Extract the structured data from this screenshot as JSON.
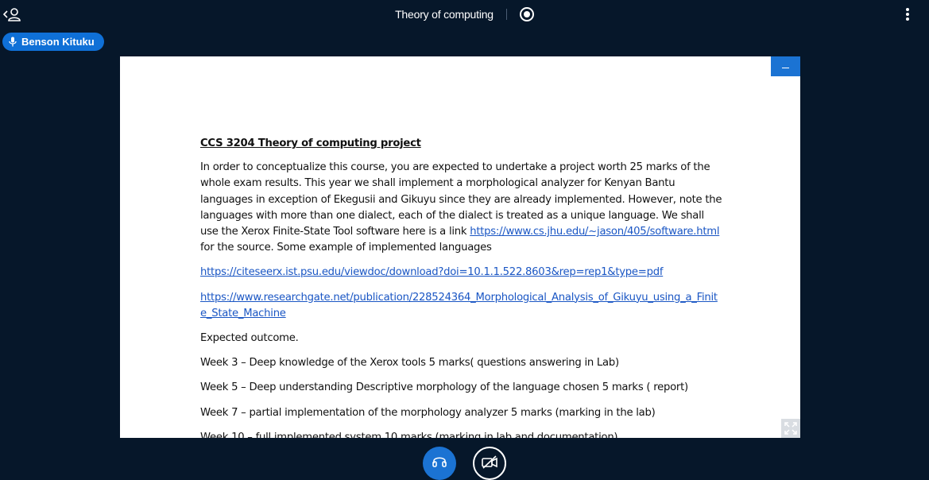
{
  "header": {
    "meeting_title": "Theory of computing"
  },
  "talker": {
    "name": "Benson Kituku"
  },
  "document": {
    "heading": "CCS 3204 Theory of computing project",
    "intro_before_link": "In order to conceptualize this course, you are expected to undertake a project worth 25 marks of the whole exam results. This year we shall implement a morphological analyzer for Kenyan Bantu languages in exception of Ekegusii and Gikuyu since they are already implemented. However, note the languages with more than one dialect, each of the dialect is treated as a  unique language. We shall  use the Xerox Finite-State Tool software here is a link ",
    "intro_link": "https://www.cs.jhu.edu/~jason/405/software.html",
    "intro_after_link": " for the source. Some example of implemented languages",
    "link_1": "https://citeseerx.ist.psu.edu/viewdoc/download?doi=10.1.1.522.8603&rep=rep1&type=pdf",
    "link_2": "https://www.researchgate.net/publication/228524364_Morphological_Analysis_of_Gikuyu_using_a_Finite_State_Machine",
    "expected_outcome": "Expected outcome.",
    "weeks": [
      "Week 3 – Deep knowledge of the Xerox tools  5 marks( questions answering in Lab)",
      "Week 5 – Deep understanding Descriptive morphology of the language chosen 5 marks ( report)",
      "Week 7 – partial implementation of the morphology analyzer 5 marks (marking in the lab)",
      "Week 10 – full implemented system 10 marks (marking in lab and documentation)"
    ]
  },
  "icons": {
    "user_list": "user-list-toggle-icon",
    "record": "record-icon",
    "options": "kebab-menu-icon",
    "mic": "microphone-icon",
    "minimize": "minimize-icon",
    "fullscreen": "fullscreen-icon",
    "audio": "headphones-icon",
    "video": "video-off-icon"
  },
  "colors": {
    "background": "#06172a",
    "accent": "#1b73d3",
    "link": "#1a56c4"
  }
}
